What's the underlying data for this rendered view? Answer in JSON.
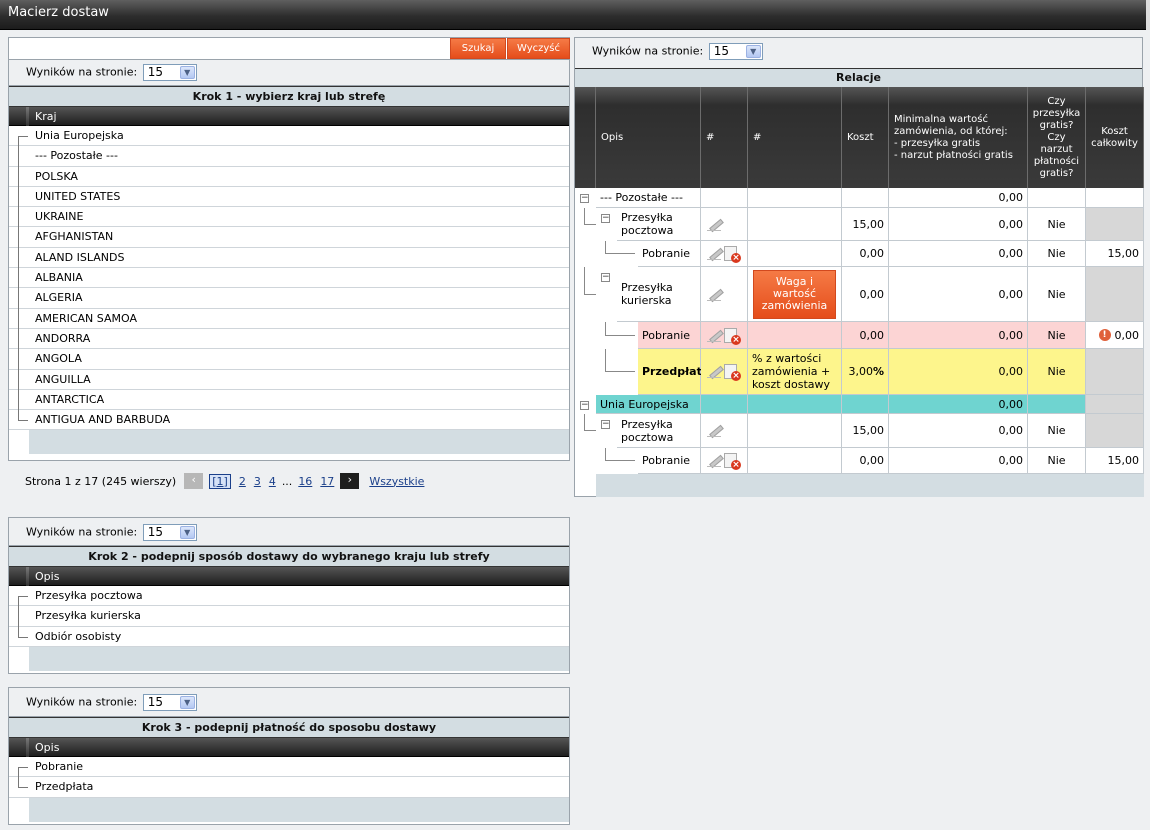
{
  "app": {
    "title": "Macierz dostaw"
  },
  "search": {
    "value": "",
    "search_label": "Szukaj",
    "clear_label": "Wyczyść"
  },
  "per_page_label": "Wyników na stronie:",
  "per_page_value": "15",
  "step1": {
    "title": "Krok 1 - wybierz kraj lub strefę",
    "column": "Kraj",
    "items": [
      "Unia Europejska",
      "--- Pozostałe ---",
      "POLSKA",
      "UNITED STATES",
      "UKRAINE",
      "AFGHANISTAN",
      "ALAND ISLANDS",
      "ALBANIA",
      "ALGERIA",
      "AMERICAN SAMOA",
      "ANDORRA",
      "ANGOLA",
      "ANGUILLA",
      "ANTARCTICA",
      "ANTIGUA AND BARBUDA"
    ],
    "pager": {
      "info": "Strona 1 z 17 (245 wierszy)",
      "prev": "‹",
      "current": "[1]",
      "pages": [
        "2",
        "3",
        "4"
      ],
      "ellipsis": "...",
      "pages_end": [
        "16",
        "17"
      ],
      "next": "›",
      "all": "Wszystkie"
    }
  },
  "step2": {
    "title": "Krok 2 - podepnij sposób dostawy do wybranego kraju lub strefy",
    "column": "Opis",
    "items": [
      "Przesyłka pocztowa",
      "Przesyłka kurierska",
      "Odbiór osobisty"
    ]
  },
  "step3": {
    "title": "Krok 3 - podepnij płatność do sposobu dostawy",
    "column": "Opis",
    "items": [
      "Pobranie",
      "Przedpłata"
    ]
  },
  "relations": {
    "title": "Relacje",
    "headers": {
      "opis": "Opis",
      "hash1": "#",
      "hash2": "#",
      "koszt": "Koszt",
      "min": "Minimalna wartość zamówienia, od której:\n- przesyłka gratis\n- narzut płatności gratis",
      "gratis": "Czy przesyłka gratis?\nCzy narzut płatności gratis?",
      "total": "Koszt całkowity"
    },
    "rows": [
      {
        "opis": "--- Pozostałe ---",
        "koszt": "",
        "min": "0,00",
        "gratis": "",
        "total": ""
      },
      {
        "opis": "Przesyłka pocztowa",
        "koszt": "15,00",
        "min": "0,00",
        "gratis": "Nie",
        "total": ""
      },
      {
        "opis": "Pobranie",
        "koszt": "0,00",
        "min": "0,00",
        "gratis": "Nie",
        "total": "15,00"
      },
      {
        "opis": "Przesyłka kurierska",
        "hash2": "Waga i wartość zamówienia",
        "koszt": "0,00",
        "min": "0,00",
        "gratis": "Nie",
        "total": ""
      },
      {
        "opis": "Pobranie",
        "koszt": "0,00",
        "min": "0,00",
        "gratis": "Nie",
        "total": "0,00"
      },
      {
        "opis": "Przedpłata",
        "hash2": "% z wartości zamówienia + koszt dostawy",
        "koszt": "3,00",
        "koszt_unit": "%",
        "min": "0,00",
        "gratis": "Nie",
        "total": ""
      },
      {
        "opis": "Unia Europejska",
        "koszt": "",
        "min": "0,00",
        "gratis": "",
        "total": ""
      },
      {
        "opis": "Przesyłka pocztowa",
        "koszt": "15,00",
        "min": "0,00",
        "gratis": "Nie",
        "total": ""
      },
      {
        "opis": "Pobranie",
        "koszt": "0,00",
        "min": "0,00",
        "gratis": "Nie",
        "total": "15,00"
      }
    ]
  },
  "colors": {
    "orange": "#ee5d2a",
    "pink_row": "#fcd4d4",
    "yellow_row": "#fdf58c",
    "teal_row": "#6fd4d0",
    "grey_cell": "#d7d7d7"
  }
}
